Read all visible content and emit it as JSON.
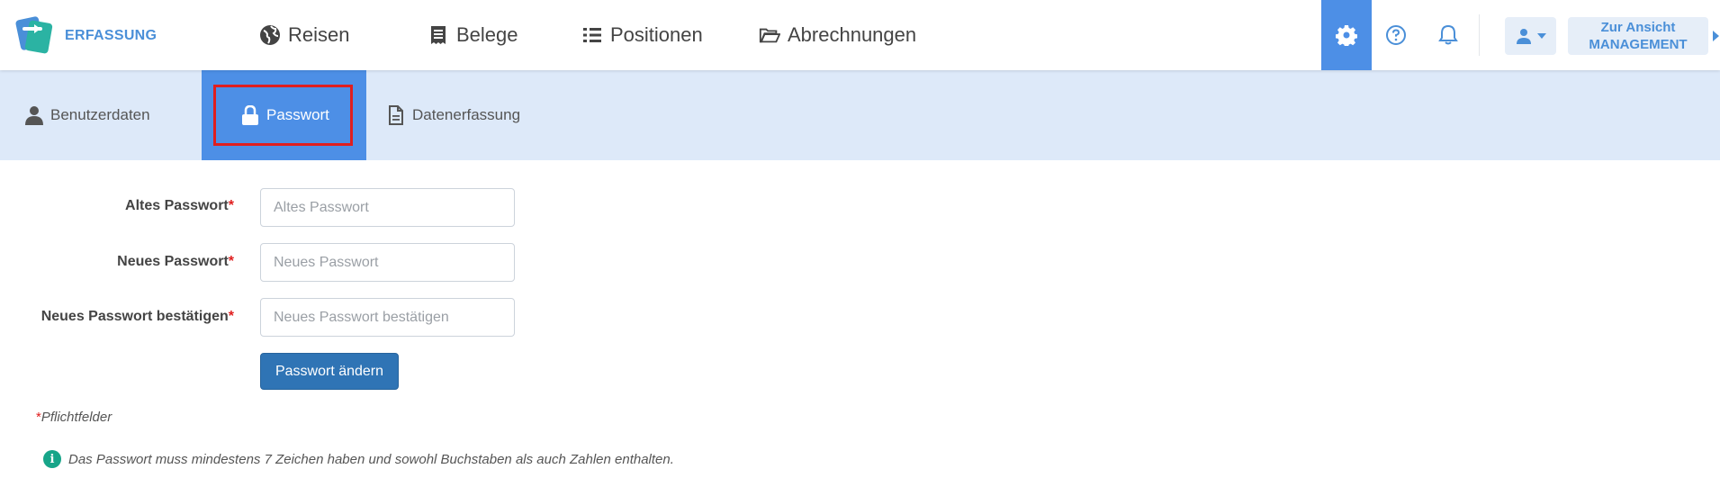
{
  "app": {
    "brand": "ERFASSUNG",
    "logo_icon": "app-logo-icon"
  },
  "nav": {
    "items": [
      {
        "label": "Reisen",
        "icon": "globe-icon"
      },
      {
        "label": "Belege",
        "icon": "receipt-icon"
      },
      {
        "label": "Positionen",
        "icon": "list-icon"
      },
      {
        "label": "Abrechnungen",
        "icon": "folder-open-icon"
      }
    ]
  },
  "topright": {
    "settings_icon": "gear-icon",
    "help_icon": "help-circle-icon",
    "notifications_icon": "bell-icon",
    "user_icon": "user-icon",
    "switch_line1": "Zur Ansicht",
    "switch_line2": "MANAGEMENT"
  },
  "subnav": {
    "tabs": [
      {
        "label": "Benutzerdaten",
        "icon": "user-icon",
        "active": false
      },
      {
        "label": "Passwort",
        "icon": "lock-icon",
        "active": true
      },
      {
        "label": "Datenerfassung",
        "icon": "document-icon",
        "active": false
      }
    ]
  },
  "form": {
    "fields": [
      {
        "label": "Altes Passwort",
        "required_mark": "*",
        "placeholder": "Altes Passwort",
        "value": ""
      },
      {
        "label": "Neues Passwort",
        "required_mark": "*",
        "placeholder": "Neues Passwort",
        "value": ""
      },
      {
        "label": "Neues Passwort bestätigen",
        "required_mark": "*",
        "placeholder": "Neues Passwort bestätigen",
        "value": ""
      }
    ],
    "submit_label": "Passwort ändern",
    "required_mark": "*",
    "required_note": "Pflichtfelder",
    "info_text": "Das Passwort muss mindestens 7 Zeichen haben und sowohl Buchstaben als auch Zahlen enthalten.",
    "info_icon_glyph": "i"
  },
  "colors": {
    "accent": "#4d8fe6",
    "subnav_bg": "#dde9f9",
    "primary_button": "#2f74b5",
    "required": "#e01e1e",
    "info": "#17a589",
    "highlight": "#e01e1e"
  }
}
